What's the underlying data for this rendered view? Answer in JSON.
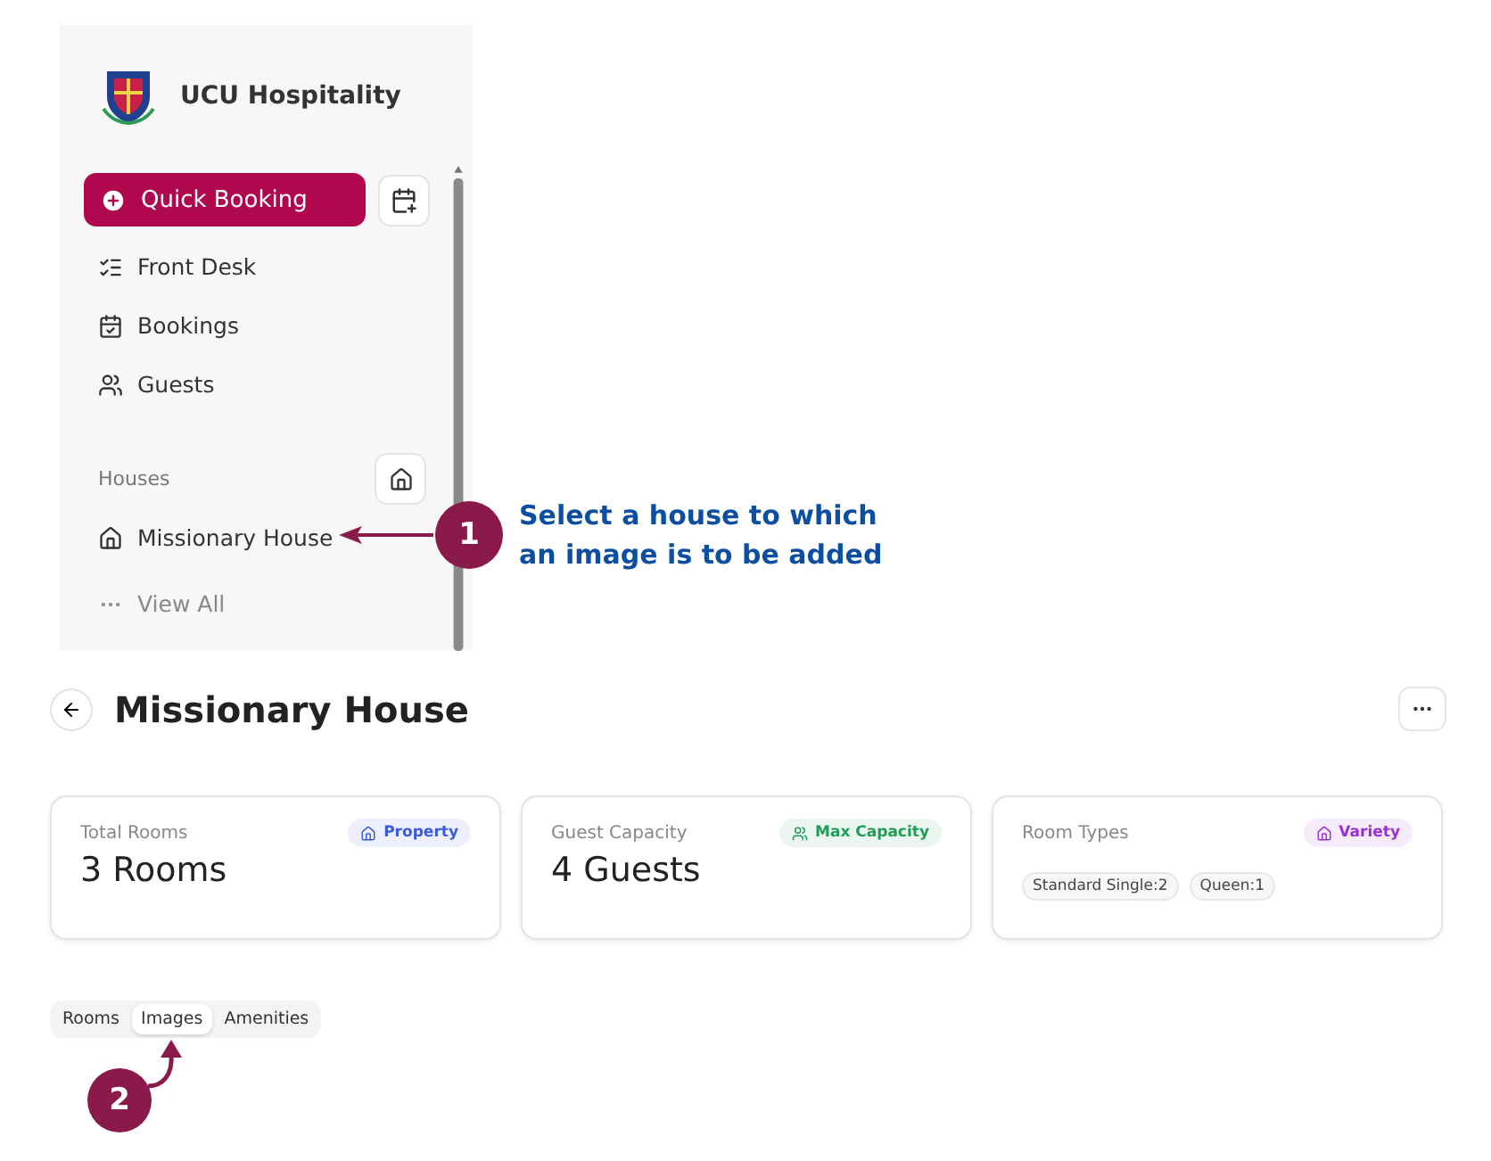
{
  "sidebar": {
    "brand": "UCU Hospitality",
    "quick_booking": "Quick Booking",
    "nav_items": [
      {
        "label": "Front Desk"
      },
      {
        "label": "Bookings"
      },
      {
        "label": "Guests"
      }
    ],
    "houses_label": "Houses",
    "houses": [
      {
        "label": "Missionary House",
        "kind": "house"
      },
      {
        "label": "View All",
        "kind": "more"
      }
    ]
  },
  "annotations": [
    {
      "number": "1",
      "text": "Select a house to which an image is to be added"
    },
    {
      "number": "2"
    }
  ],
  "page": {
    "title": "Missionary House",
    "cards": [
      {
        "label": "Total Rooms",
        "value": "3 Rooms",
        "badge": "Property",
        "color": "#3b5bdb"
      },
      {
        "label": "Guest Capacity",
        "value": "4 Guests",
        "badge": "Max Capacity",
        "color": "#1e9e55"
      },
      {
        "label": "Room Types",
        "badge": "Variety",
        "color": "#9b2fd6",
        "chips": [
          "Standard Single:2",
          "Queen:1"
        ]
      }
    ],
    "tabs": [
      {
        "label": "Rooms",
        "selected": false
      },
      {
        "label": "Images",
        "selected": true
      },
      {
        "label": "Amenities",
        "selected": false
      }
    ]
  }
}
